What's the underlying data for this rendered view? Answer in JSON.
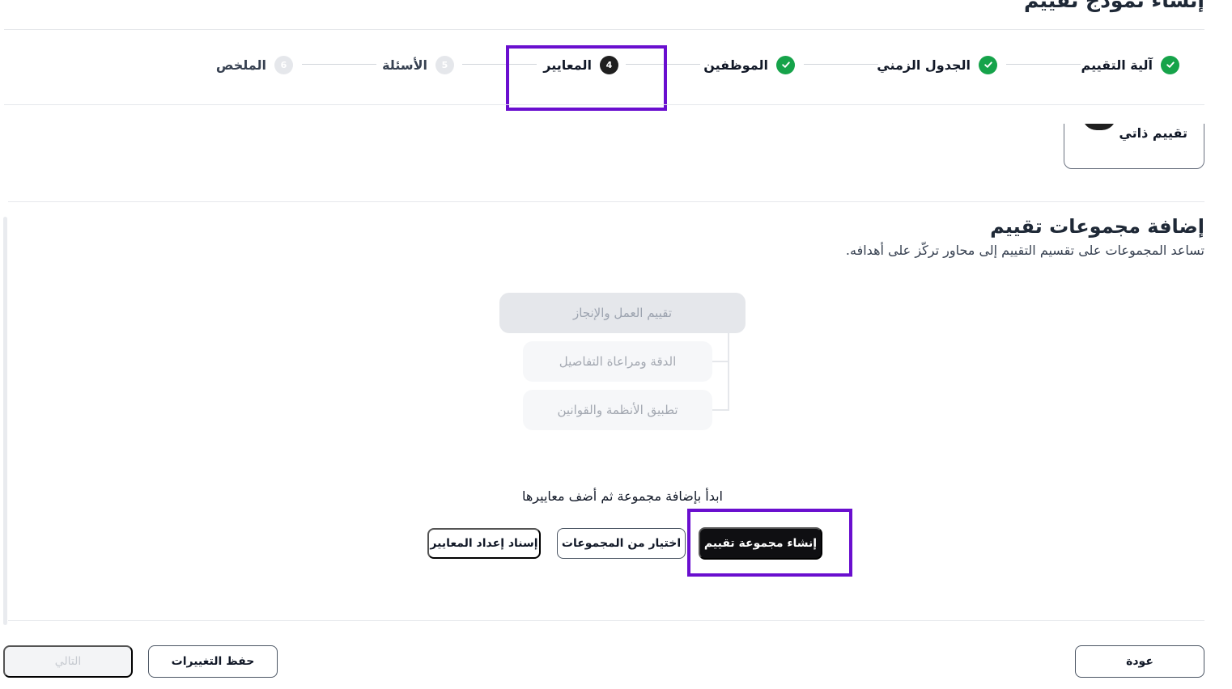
{
  "page": {
    "title": "إنشاء نموذج تقييم"
  },
  "stepper": {
    "steps": [
      {
        "label": "آلية التقييم",
        "status": "completed",
        "icon": "check-circle-icon"
      },
      {
        "label": "الجدول الزمني",
        "status": "completed",
        "icon": "check-circle-icon"
      },
      {
        "label": "الموظفين",
        "status": "completed",
        "icon": "check-circle-icon"
      },
      {
        "label": "المعايير",
        "number": "4",
        "status": "current"
      },
      {
        "label": "الأسئلة",
        "number": "5",
        "status": "upcoming"
      },
      {
        "label": "الملخص",
        "number": "6",
        "status": "upcoming"
      }
    ]
  },
  "self_assessment": {
    "label": "تقييم ذاتي"
  },
  "groups_section": {
    "title": "إضافة مجموعات تقييم",
    "description": "تساعد المجموعات على تقسيم التقييم إلى محاور تركّز على أهدافه.",
    "illustration": {
      "parent": "تقييم العمل والإنجاز",
      "children": [
        "الدقة ومراعاة التفاصيل",
        "تطبيق الأنظمة والقوانين"
      ]
    },
    "empty_text": "ابدأ بإضافة مجموعة ثم أضف معاييرها",
    "create_group_label": "إنشاء مجموعة تقييم",
    "choose_from_groups_label": "اختيار من المجموعات",
    "assign_criteria_label": "إسناد إعداد المعايير"
  },
  "footer": {
    "back_label": "عودة",
    "save_label": "حفظ التغييرات",
    "next_label": "التالي"
  },
  "colors": {
    "accent_highlight": "#6a0fcf",
    "success": "#16a34a",
    "primary_button": "#0f0f12"
  }
}
